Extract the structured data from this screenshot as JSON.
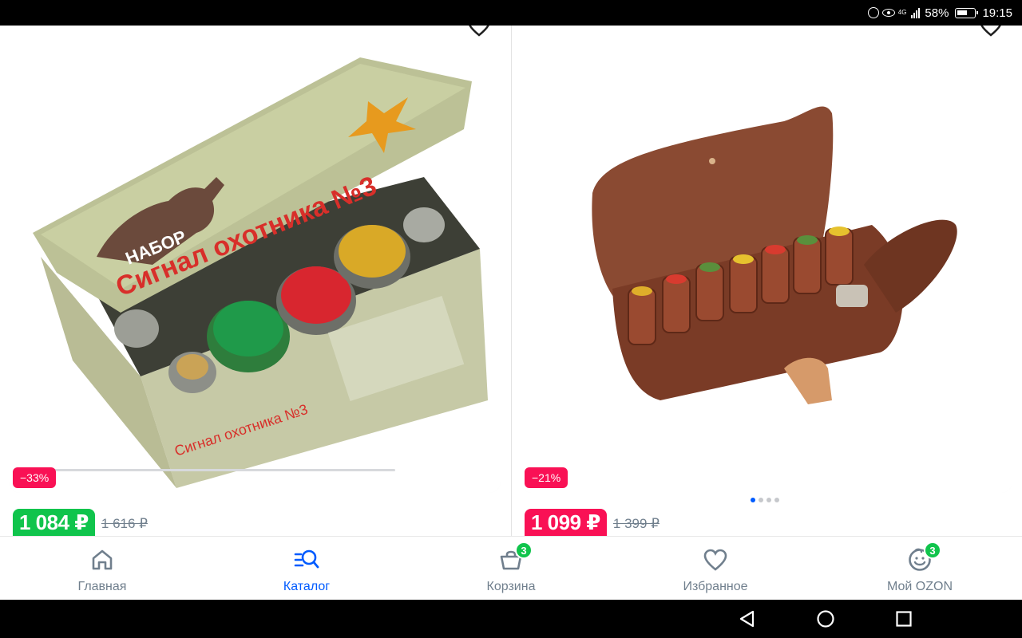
{
  "status_bar": {
    "network": "4G",
    "battery": "58%",
    "time": "19:15"
  },
  "products": [
    {
      "discount": "−33%",
      "price": "1 084 ₽",
      "old_price": "1 616 ₽",
      "box_text_top": "НАБОР",
      "box_text_main": "Сигнал охотника №3",
      "price_color": "#10c44c"
    },
    {
      "discount": "−21%",
      "price": "1 099 ₽",
      "old_price": "1 399 ₽",
      "price_color": "#f91155",
      "gallery": {
        "total": 4,
        "active": 1
      }
    }
  ],
  "tabbar": {
    "items": [
      {
        "label": "Главная",
        "icon": "home-icon",
        "active": false
      },
      {
        "label": "Каталог",
        "icon": "catalog-search-icon",
        "active": true
      },
      {
        "label": "Корзина",
        "icon": "cart-icon",
        "badge": "3",
        "active": false
      },
      {
        "label": "Избранное",
        "icon": "heart-icon",
        "active": false
      },
      {
        "label": "Мой OZON",
        "icon": "profile-smile-icon",
        "badge": "3",
        "active": false
      }
    ]
  },
  "colors": {
    "accent": "#005bff",
    "discount": "#f91155",
    "green_price": "#10c44c",
    "muted": "#707f8d"
  }
}
